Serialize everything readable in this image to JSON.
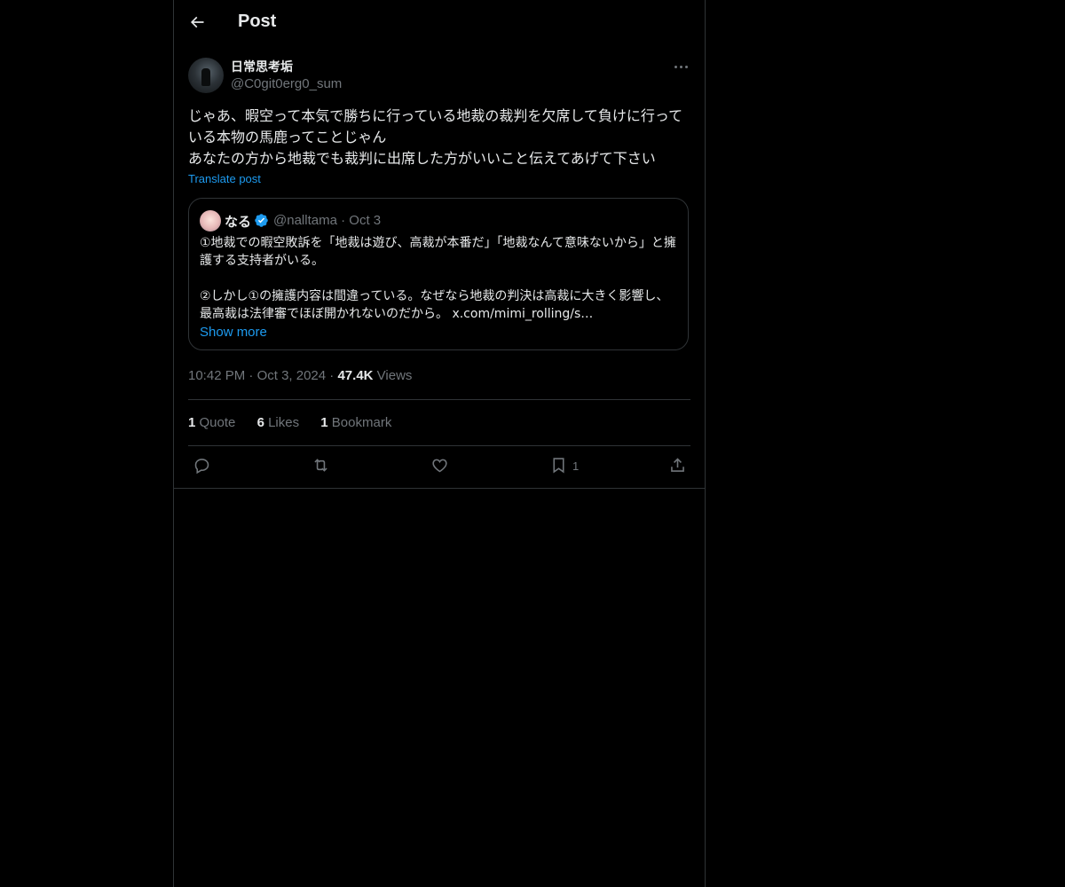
{
  "header": {
    "title": "Post"
  },
  "tweet": {
    "author_name": "日常思考垢",
    "author_handle": "@C0git0erg0_sum",
    "text": "じゃあ、暇空って本気で勝ちに行っている地裁の裁判を欠席して負けに行っている本物の馬鹿ってことじゃん\nあなたの方から地裁でも裁判に出席した方がいいこと伝えてあげて下さい",
    "translate_label": "Translate post",
    "time": "10:42 PM",
    "date": "Oct 3, 2024",
    "views_count": "47.4K",
    "views_label": "Views"
  },
  "quote": {
    "name": "なる",
    "handle": "@nalltama",
    "date": "Oct 3",
    "text": "①地裁での暇空敗訴を「地裁は遊び、高裁が本番だ」「地裁なんて意味ないから」と擁護する支持者がいる。\n\n②しかし①の擁護内容は間違っている。なぜなら地裁の判決は高裁に大きく影響し、最高裁は法律審でほぼ開かれないのだから。 x.com/mimi_rolling/s…",
    "show_more": "Show more"
  },
  "stats": {
    "quotes_count": "1",
    "quotes_label": "Quote",
    "likes_count": "6",
    "likes_label": "Likes",
    "bookmarks_count": "1",
    "bookmarks_label": "Bookmark"
  },
  "actions": {
    "bookmark_count": "1"
  },
  "icons": [
    "back-arrow-icon",
    "more-icon",
    "verified-icon",
    "reply-icon",
    "retweet-icon",
    "like-icon",
    "bookmark-icon",
    "share-icon"
  ],
  "colors": {
    "background": "#000000",
    "text": "#e7e9ea",
    "secondary": "#71767b",
    "accent": "#1d9bf0",
    "border": "#2f3336"
  }
}
